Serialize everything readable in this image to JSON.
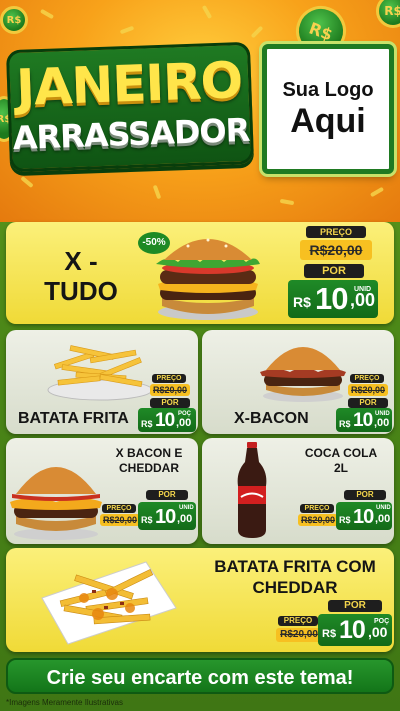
{
  "header": {
    "title_line1": "JANEIRO",
    "title_line2": "ARRASSADOR",
    "logo_line1": "Sua Logo",
    "logo_line2": "Aqui",
    "coin_symbol": "R$"
  },
  "featured": {
    "name_line1": "X -",
    "name_line2": "TUDO",
    "discount_badge": "-50%",
    "preco_label": "PREÇO",
    "old_price": "R$20,00",
    "por_label": "POR",
    "currency": "R$",
    "price_int": "10",
    "price_cents": ",00",
    "unit": "UNID"
  },
  "products": [
    {
      "name": "BATATA FRITA",
      "preco_label": "PREÇO",
      "old_price": "R$20,00",
      "por_label": "POR",
      "currency": "R$",
      "price_int": "10",
      "price_cents": ",00",
      "unit": "POÇ"
    },
    {
      "name": "X-BACON",
      "preco_label": "PREÇO",
      "old_price": "R$20,00",
      "por_label": "POR",
      "currency": "R$",
      "price_int": "10",
      "price_cents": ",00",
      "unit": "UNID"
    },
    {
      "name_line1": "X BACON E",
      "name_line2": "CHEDDAR",
      "preco_label": "PREÇO",
      "old_price": "R$20,00",
      "por_label": "POR",
      "currency": "R$",
      "price_int": "10",
      "price_cents": ",00",
      "unit": "UNID"
    },
    {
      "name_line1": "COCA COLA",
      "name_line2": "2L",
      "preco_label": "PREÇO",
      "old_price": "R$20,00",
      "por_label": "POR",
      "currency": "R$",
      "price_int": "10",
      "price_cents": ",00",
      "unit": "UNID"
    },
    {
      "name_line1": "BATATA FRITA COM",
      "name_line2": "CHEDDAR",
      "preco_label": "PREÇO",
      "old_price": "R$20,00",
      "por_label": "POR",
      "currency": "R$",
      "price_int": "10",
      "price_cents": ",00",
      "unit": "POÇ"
    }
  ],
  "cta": "Crie seu encarte com este tema!",
  "disclaimer": "*Imagens Meramente Ilustrativas",
  "colors": {
    "green_dark": "#136a18",
    "yellow": "#f0da37",
    "orange": "#f8a21a"
  }
}
